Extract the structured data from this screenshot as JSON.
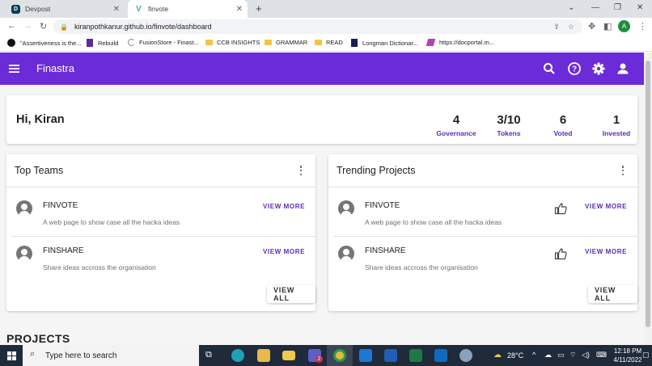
{
  "browser": {
    "tabs": [
      {
        "title": "Devpost",
        "favicon": "D"
      },
      {
        "title": "finvote",
        "favicon": "V"
      }
    ],
    "url": "kiranpothkanur.github.io/finvote/dashboard",
    "profile_initial": "A",
    "bookmarks": [
      {
        "label": "\"Assertiveness is the...",
        "icon": "globe-icon"
      },
      {
        "label": "Rebuild",
        "icon": "bookmark-icon"
      },
      {
        "label": "FusionStore - Finast...",
        "icon": "loading-icon"
      },
      {
        "label": "CCB INSIGHTS",
        "icon": "folder-icon"
      },
      {
        "label": "GRAMMAR",
        "icon": "folder-icon"
      },
      {
        "label": "READ",
        "icon": "folder-icon"
      },
      {
        "label": "Longman Dictionar...",
        "icon": "book-icon"
      },
      {
        "label": "https://docportal.m...",
        "icon": "link-icon"
      }
    ]
  },
  "app": {
    "title": "Finastra",
    "colors": {
      "primary": "#6c2bd9",
      "accent": "#5b2bb5"
    }
  },
  "greeting": {
    "text": "Hi, Kiran",
    "stats": [
      {
        "value": "4",
        "label": "Governance"
      },
      {
        "value": "3/10",
        "label": "Tokens"
      },
      {
        "value": "6",
        "label": "Voted"
      },
      {
        "value": "1",
        "label": "Invested"
      }
    ]
  },
  "top_teams": {
    "title": "Top Teams",
    "items": [
      {
        "name": "FINVOTE",
        "description": "A web page to show case all the hacka ideas",
        "action": "VIEW MORE"
      },
      {
        "name": "FINSHARE",
        "description": "Share ideas accross the organisation",
        "action": "VIEW MORE"
      }
    ],
    "view_all": "VIEW ALL"
  },
  "trending_projects": {
    "title": "Trending Projects",
    "items": [
      {
        "name": "FINVOTE",
        "description": "A web page to show case all the hacka ideas",
        "action": "VIEW MORE"
      },
      {
        "name": "FINSHARE",
        "description": "Share ideas accross the organisation",
        "action": "VIEW MORE"
      }
    ],
    "view_all": "VIEW ALL"
  },
  "projects_heading": "PROJECTS",
  "taskbar": {
    "search_placeholder": "Type here to search",
    "weather": "28°C",
    "time": "12:18 PM",
    "date": "4/11/2022",
    "teams_badge": "2"
  }
}
